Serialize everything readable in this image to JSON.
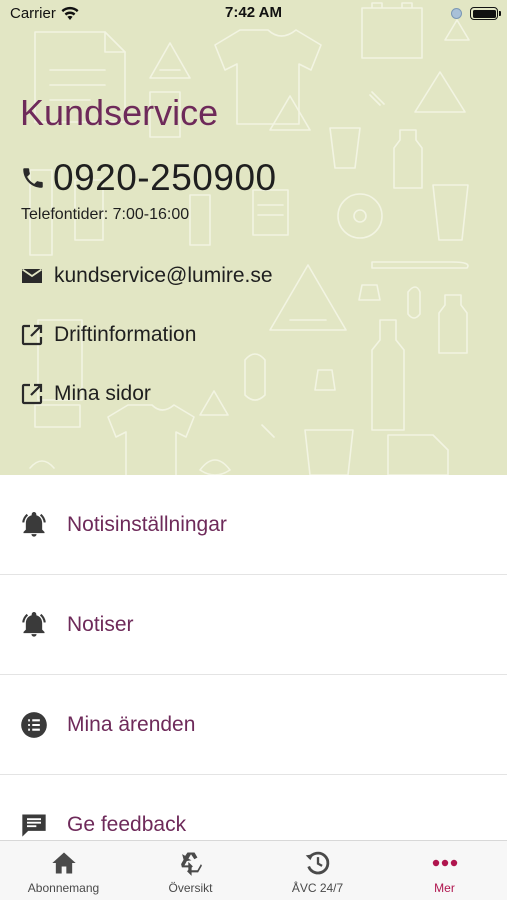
{
  "status_bar": {
    "carrier": "Carrier",
    "time": "7:42 AM"
  },
  "contact": {
    "title": "Kundservice",
    "phone": "0920-250900",
    "hours": "Telefontider: 7:00-16:00",
    "links": [
      {
        "label": "kundservice@lumire.se",
        "icon": "mail-icon"
      },
      {
        "label": "Driftinformation",
        "icon": "external-link-icon"
      },
      {
        "label": "Mina sidor",
        "icon": "external-link-icon"
      }
    ]
  },
  "menu": {
    "items": [
      {
        "label": "Notisinställningar",
        "icon": "bell-icon"
      },
      {
        "label": "Notiser",
        "icon": "bell-icon"
      },
      {
        "label": "Mina ärenden",
        "icon": "list-icon"
      },
      {
        "label": "Ge feedback",
        "icon": "feedback-icon"
      }
    ]
  },
  "tabbar": {
    "tabs": [
      {
        "label": "Abonnemang",
        "icon": "house-icon",
        "active": false
      },
      {
        "label": "Översikt",
        "icon": "recycle-icon",
        "active": false
      },
      {
        "label": "ÅVC 24/7",
        "icon": "clock-recycle-icon",
        "active": false
      },
      {
        "label": "Mer",
        "icon": "more-dots-icon",
        "active": true
      }
    ]
  },
  "colors": {
    "hero_background": "#e2e6c4",
    "title_purple": "#6e2a5a",
    "menu_text_purple": "#6e2a5a",
    "active_tab": "#b0154e",
    "text_dark": "#1f1f1f"
  }
}
